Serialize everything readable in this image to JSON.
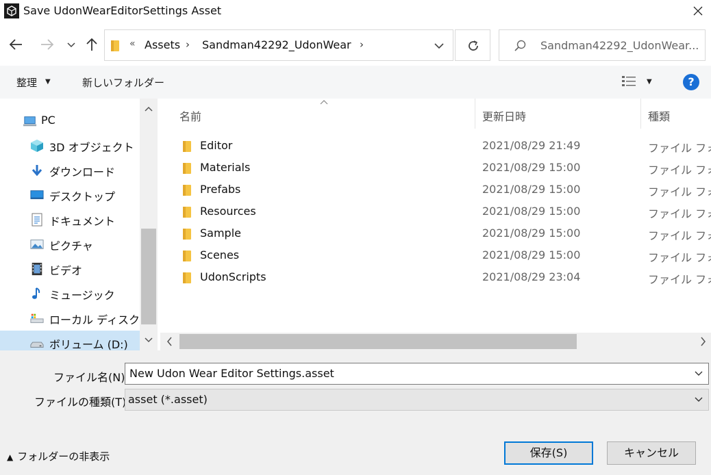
{
  "window": {
    "title": "Save UdonWearEditorSettings Asset"
  },
  "nav": {
    "breadcrumb_overflow": "«",
    "breadcrumbs": [
      "Assets",
      "Sandman42292_UdonWear"
    ],
    "search_placeholder": "Sandman42292_UdonWear..."
  },
  "toolbar": {
    "organize_label": "整理",
    "new_folder_label": "新しいフォルダー",
    "help_label": "?"
  },
  "navpane": {
    "items": [
      {
        "label": "PC",
        "icon": "pc-icon"
      },
      {
        "label": "3D オブジェクト",
        "icon": "3d-objects-icon"
      },
      {
        "label": "ダウンロード",
        "icon": "downloads-icon"
      },
      {
        "label": "デスクトップ",
        "icon": "desktop-icon"
      },
      {
        "label": "ドキュメント",
        "icon": "documents-icon"
      },
      {
        "label": "ピクチャ",
        "icon": "pictures-icon"
      },
      {
        "label": "ビデオ",
        "icon": "videos-icon"
      },
      {
        "label": "ミュージック",
        "icon": "music-icon"
      },
      {
        "label": "ローカル ディスク (C",
        "icon": "local-disk-icon"
      },
      {
        "label": "ボリューム (D:)",
        "icon": "drive-icon",
        "selected": true
      }
    ]
  },
  "filelist": {
    "columns": {
      "name": "名前",
      "date": "更新日時",
      "type": "種類"
    },
    "rows": [
      {
        "name": "Editor",
        "date": "2021/08/29 21:49",
        "type": "ファイル フォルダー"
      },
      {
        "name": "Materials",
        "date": "2021/08/29 15:00",
        "type": "ファイル フォルダー"
      },
      {
        "name": "Prefabs",
        "date": "2021/08/29 15:00",
        "type": "ファイル フォルダー"
      },
      {
        "name": "Resources",
        "date": "2021/08/29 15:00",
        "type": "ファイル フォルダー"
      },
      {
        "name": "Sample",
        "date": "2021/08/29 15:00",
        "type": "ファイル フォルダー"
      },
      {
        "name": "Scenes",
        "date": "2021/08/29 15:00",
        "type": "ファイル フォルダー"
      },
      {
        "name": "UdonScripts",
        "date": "2021/08/29 23:04",
        "type": "ファイル フォルダー"
      }
    ]
  },
  "footer": {
    "filename_label": "ファイル名(N):",
    "filename_value": "New Udon Wear Editor Settings.asset",
    "filetype_label": "ファイルの種類(T):",
    "filetype_value": "asset (*.asset)",
    "hide_folders_label": "フォルダーの非表示",
    "save_label": "保存(S)",
    "cancel_label": "キャンセル"
  },
  "colors": {
    "accent": "#0078d7",
    "selection": "#cce4f7",
    "folder": "#f5c443",
    "help": "#1a6fd6"
  }
}
